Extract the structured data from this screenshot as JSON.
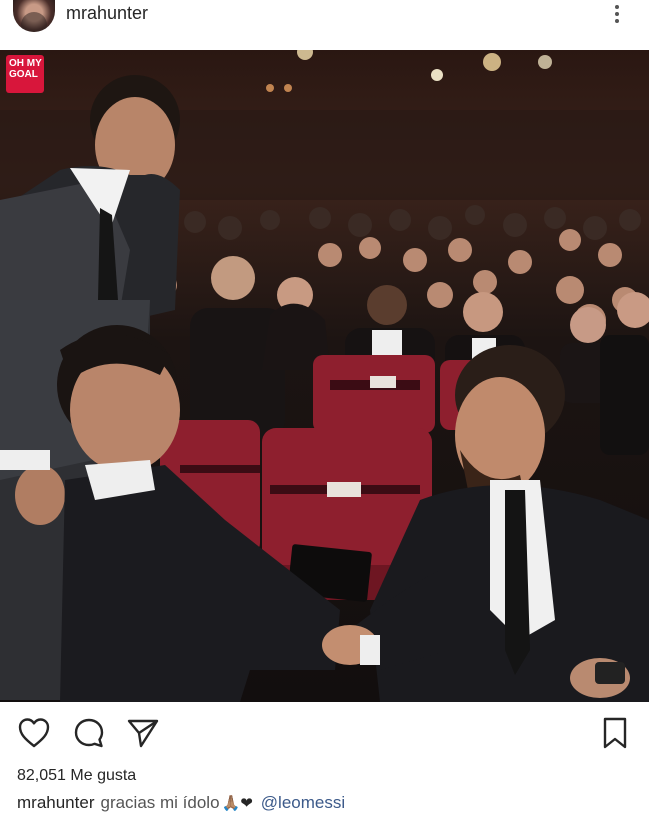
{
  "post": {
    "username": "mrahunter",
    "badge_text": "OH MY GOAL",
    "likes_count": "82,051",
    "likes_label": "Me gusta",
    "caption_user": "mrahunter",
    "caption_text": "gracias mi ídolo",
    "caption_emojis": "🙏🏽❤",
    "caption_mention": "@leomessi"
  },
  "icons": {
    "more": "more-vertical-icon",
    "like": "heart-icon",
    "comment": "comment-icon",
    "share": "send-icon",
    "save": "bookmark-icon"
  },
  "colors": {
    "badge_bg": "#d8163b",
    "mention": "#3c5a8a",
    "seat_red": "#8e1f2e"
  }
}
